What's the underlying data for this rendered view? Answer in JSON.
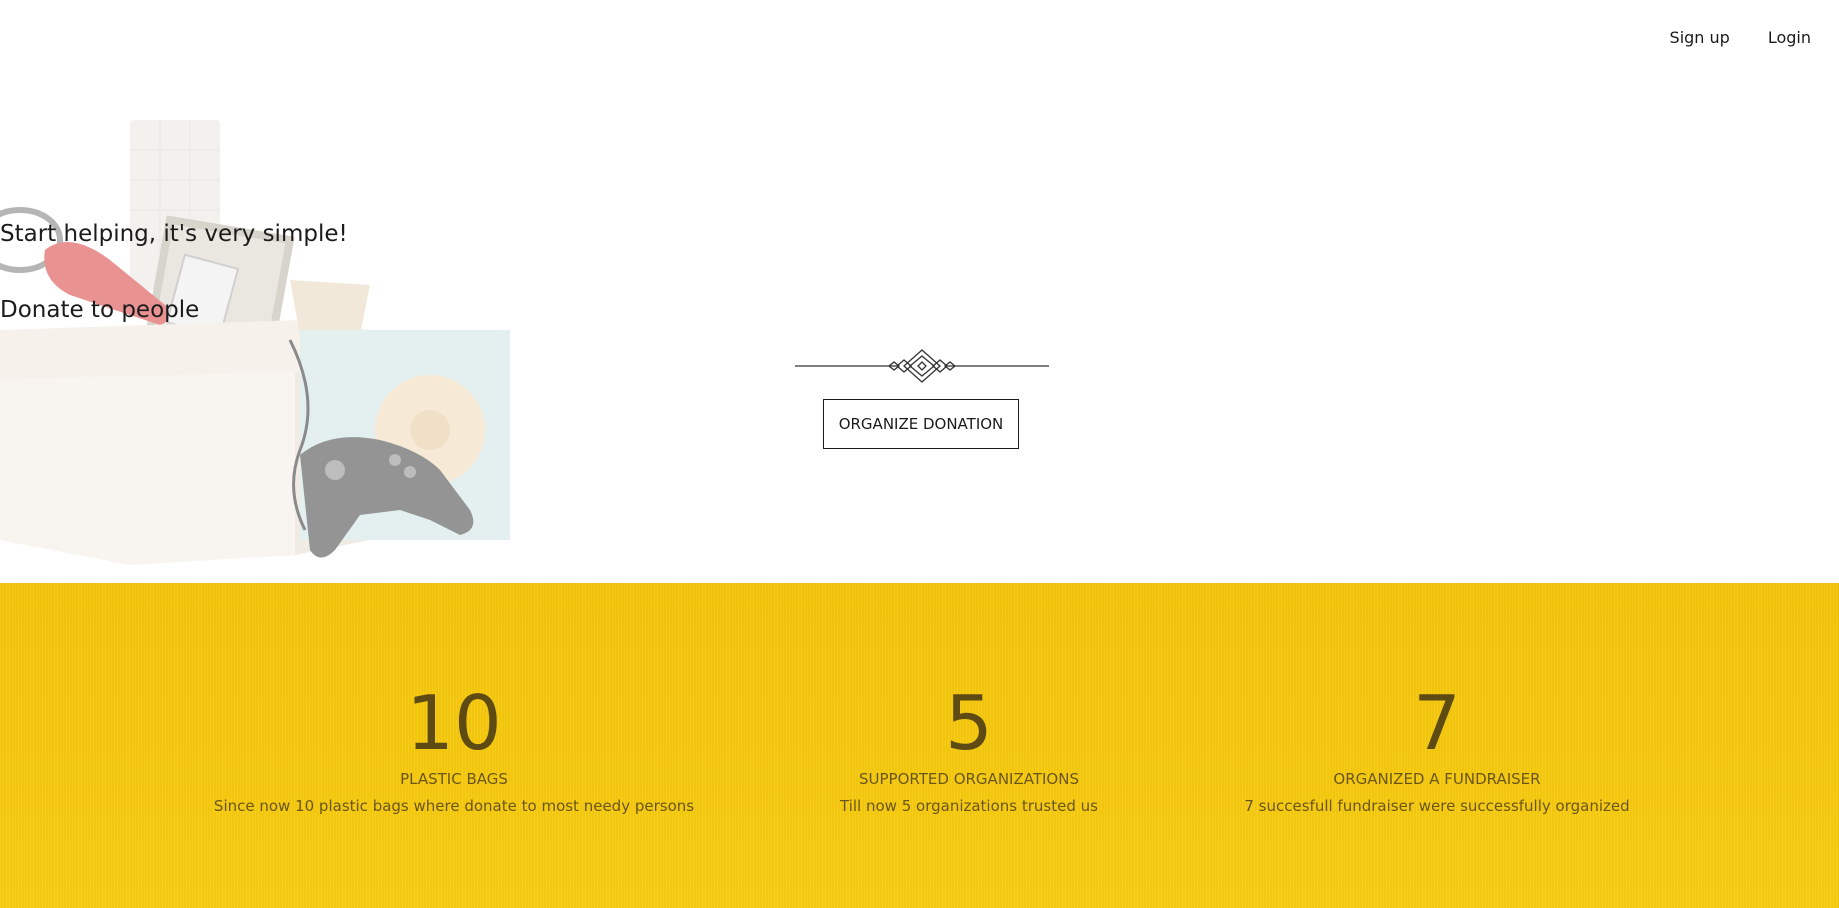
{
  "nav": {
    "signup_label": "Sign up",
    "login_label": "Login"
  },
  "hero": {
    "title": "Start helping, it's very simple!",
    "subtitle": "Donate to people",
    "button_label": "ORGANIZE DONATION"
  },
  "stats": [
    {
      "number": "10",
      "label": "PLASTIC BAGS",
      "description": "Since now 10 plastic bags where donate to most needy persons"
    },
    {
      "number": "5",
      "label": "SUPPORTED ORGANIZATIONS",
      "description": "Till now 5 organizations trusted us"
    },
    {
      "number": "7",
      "label": "ORGANIZED A FUNDRAISER",
      "description": "7 succesfull fundraiser were successfully organized"
    }
  ],
  "colors": {
    "stats_background": "#f6c90c",
    "stats_text": "#5e4b14",
    "text": "#1b1b1b"
  }
}
